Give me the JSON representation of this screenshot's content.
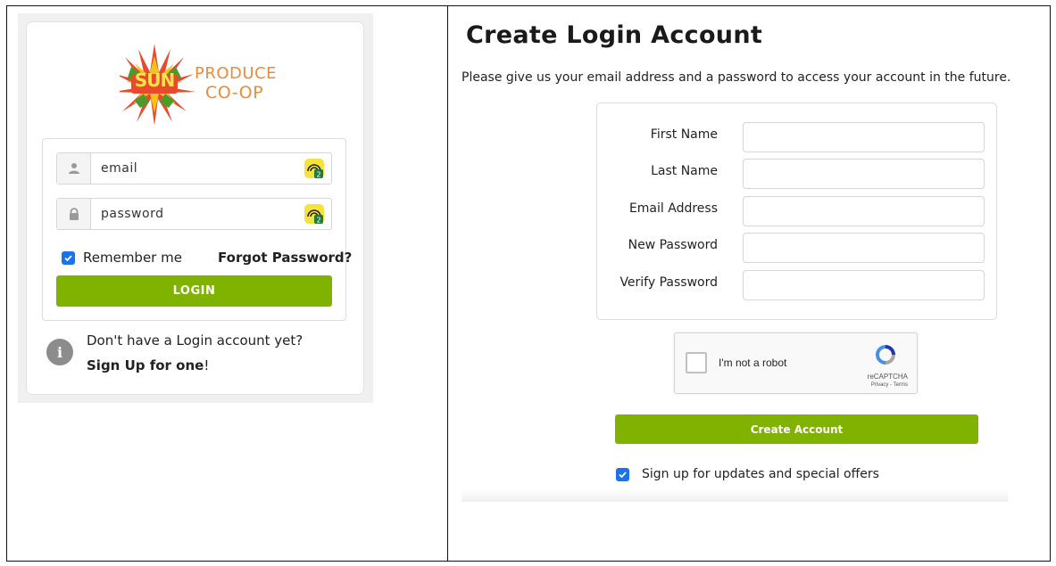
{
  "login": {
    "logo": {
      "sun": "SUN",
      "produce": "PRODUCE",
      "coop": "CO-OP"
    },
    "email_placeholder": "email",
    "password_placeholder": "password",
    "remember_label": "Remember me",
    "forgot_label": "Forgot Password?",
    "login_button": "LOGIN",
    "no_account_text": "Don't have a Login account yet?",
    "signup_link": "Sign Up for one",
    "signup_suffix": "!",
    "remember_checked": true
  },
  "register": {
    "title": "Create Login Account",
    "subtitle": "Please give us your email address and a password to access your account in the future.",
    "fields": [
      {
        "label": "First Name",
        "value": ""
      },
      {
        "label": "Last Name",
        "value": ""
      },
      {
        "label": "Email Address",
        "value": ""
      },
      {
        "label": "New Password",
        "value": ""
      },
      {
        "label": "Verify Password",
        "value": ""
      }
    ],
    "captcha": {
      "label": "I'm not a robot",
      "brand": "reCAPTCHA",
      "links": "Privacy - Terms"
    },
    "create_button": "Create Account",
    "updates_label": "Sign up for updates and special offers",
    "updates_checked": true
  },
  "colors": {
    "accent_green": "#80b300",
    "checkbox_blue": "#1a73e8",
    "logo_orange": "#f08a3a"
  }
}
